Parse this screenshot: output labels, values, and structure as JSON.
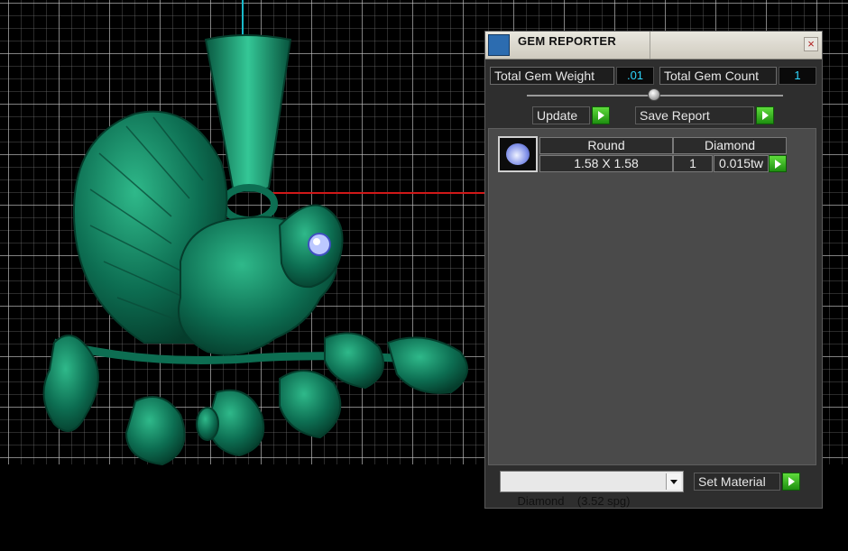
{
  "panel": {
    "title": "GEM REPORTER",
    "close_glyph": "×",
    "total_weight_label": "Total Gem Weight",
    "total_weight_value": ".01",
    "total_count_label": "Total Gem Count",
    "total_count_value": "1",
    "update_label": "Update",
    "save_report_label": "Save Report",
    "report": {
      "columns": [
        "Round",
        "Diamond"
      ],
      "rows": [
        {
          "size": "1.58 X 1.58",
          "qty": "1",
          "weight": "0.015tw"
        }
      ]
    },
    "material_select_value": "Diamond    (3.52 spg)",
    "set_material_label": "Set Material"
  },
  "colors": {
    "model": "#0f7a5c",
    "accent_cyan": "#2fd8ff",
    "go_green": "#3ec42a"
  },
  "icons": [
    "app-icon",
    "close-icon",
    "play-arrow-icon",
    "gem-thumbnail-icon",
    "dropdown-arrow-icon"
  ]
}
